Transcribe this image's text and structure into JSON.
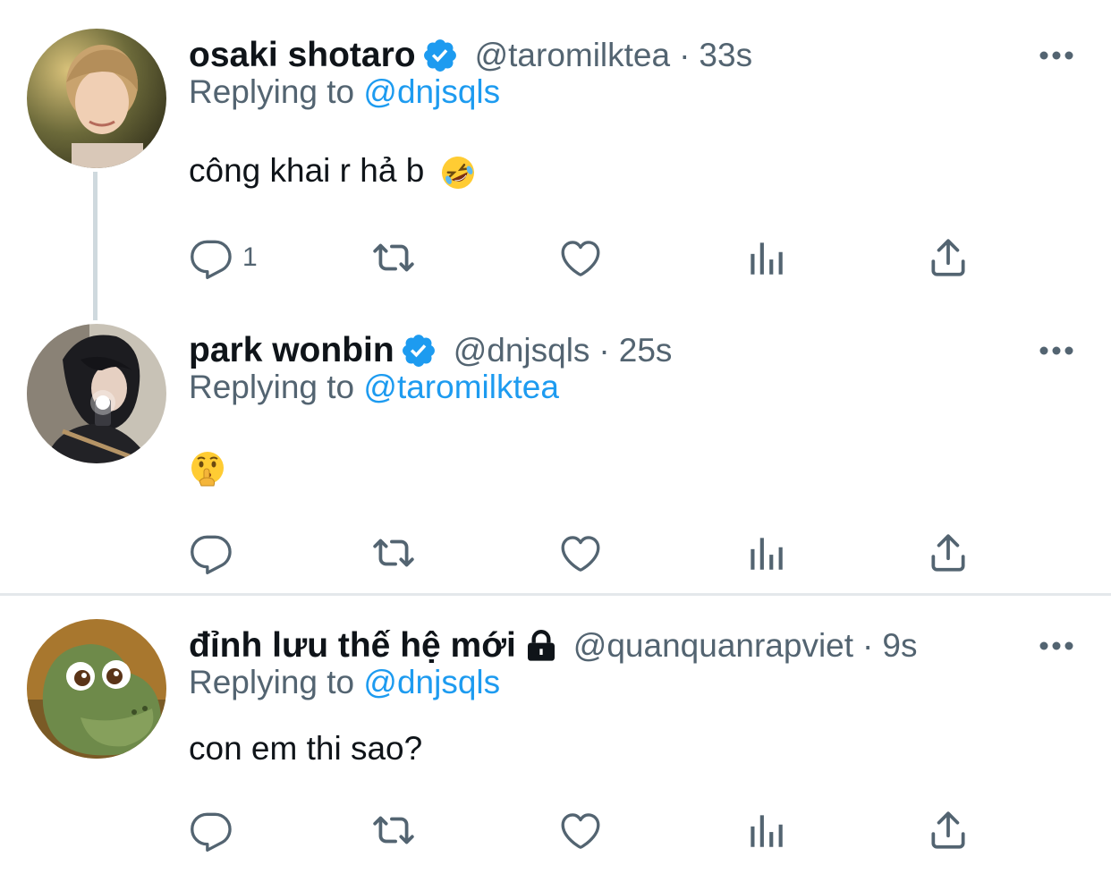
{
  "tweets": [
    {
      "name": "osaki shotaro",
      "handle": "@taromilktea",
      "separator": "·",
      "time": "33s",
      "replying_label": "Replying to",
      "replying_to": "@dnjsqls",
      "text": "công khai r hả b",
      "emoji": "rolling-on-floor-laughing",
      "reply_count": "1",
      "verified": true
    },
    {
      "name": "park wonbin",
      "handle": "@dnjsqls",
      "separator": "·",
      "time": "25s",
      "replying_label": "Replying to",
      "replying_to": "@taromilktea",
      "text": "",
      "emoji": "shushing-face",
      "reply_count": "",
      "verified": true
    },
    {
      "name": "đỉnh lưu thế hệ mới",
      "handle": "@quanquanrapviet",
      "separator": "·",
      "time": "9s",
      "replying_label": "Replying to",
      "replying_to": "@dnjsqls",
      "text": "con em thi sao?",
      "emoji": "",
      "reply_count": "",
      "verified": false,
      "locked": true
    }
  ],
  "colors": {
    "accent": "#1d9bf0",
    "muted_text": "#536471",
    "primary_text": "#0f1419",
    "icon": "#536471"
  },
  "icons": [
    "reply-icon",
    "retweet-icon",
    "like-icon",
    "views-icon",
    "share-icon",
    "more-icon",
    "verified-icon",
    "lock-icon"
  ]
}
